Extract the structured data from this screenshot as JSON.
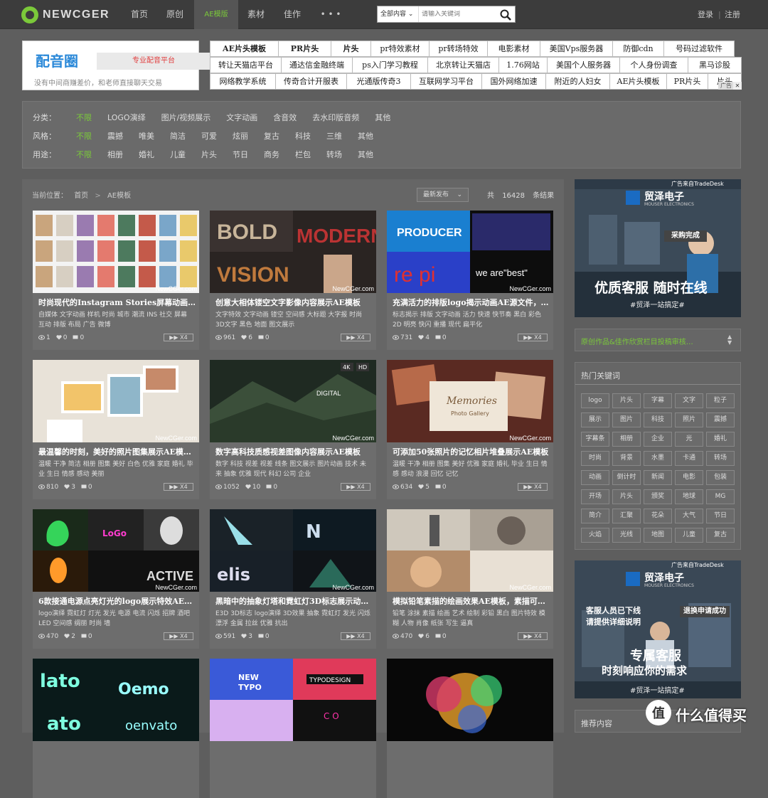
{
  "brand": "NEWCGER",
  "nav": [
    "首页",
    "原创",
    "AE模版",
    "素材",
    "佳作",
    "• • •"
  ],
  "search": {
    "scope": "全部内容",
    "placeholder": "请输入关键词"
  },
  "auth": {
    "login": "登录",
    "register": "注册"
  },
  "ad_left": {
    "title": "配音圈",
    "pill": "专业配音平台",
    "sub": "没有中间商赚差价，和老师直接聊天交易"
  },
  "ad_links": [
    [
      "AE片头模板",
      "PR片头",
      "片头",
      "pr特效素材",
      "pr转场特效",
      "电影素材",
      "美国Vps服务器",
      "防御cdn",
      "号码过滤软件"
    ],
    [
      "转让天猫店平台",
      "通达信金融终端",
      "ps入门学习教程",
      "北京转让天猫店",
      "1.76网站",
      "美国个人服务器",
      "个人身份调查",
      "黑马诊股"
    ],
    [
      "网络教学系统",
      "传奇合计开服表",
      "光通版传奇3",
      "互联网学习平台",
      "国外网络加速",
      "附近的人妇女",
      "AE片头模板",
      "PR片头",
      "片头"
    ]
  ],
  "ad_flag": "广告",
  "filters": [
    {
      "label": "分类：",
      "items": [
        "不限",
        "LOGO演绎",
        "图片/视频展示",
        "文字动画",
        "含音效",
        "去水印版音频",
        "其他"
      ]
    },
    {
      "label": "风格：",
      "items": [
        "不限",
        "震撼",
        "唯美",
        "简洁",
        "可爱",
        "炫丽",
        "复古",
        "科技",
        "三维",
        "其他"
      ]
    },
    {
      "label": "用途：",
      "items": [
        "不限",
        "相册",
        "婚礼",
        "儿童",
        "片头",
        "节日",
        "商务",
        "栏包",
        "转场",
        "其他"
      ]
    }
  ],
  "breadcrumb": {
    "prefix": "当前位置：",
    "home": "首页",
    "sep": ">",
    "current": "AE模板"
  },
  "sort": "最新发布",
  "result": {
    "pre": "共",
    "count": "16428",
    "post": "条结果"
  },
  "watermark": "NewCGer.com",
  "play_label": "X4",
  "cards": [
    {
      "title": "时尚现代的Instagram Stories屏幕动画…",
      "tags": "自媒体 文字动画 样机 时尚 城市 潮流 INS 社交 屏幕 互动 排版 布局 广告 微博",
      "views": "1",
      "likes": "0",
      "comments": "0"
    },
    {
      "title": "创意大相体镂空文字影像内容展示AE模板",
      "tags": "文字特效 文字动画 镂空 空间感 大标题 大字报 时尚 3D文字 黑色 地面 图文展示",
      "views": "961",
      "likes": "6",
      "comments": "0"
    },
    {
      "title": "充满活力的排版logo揭示动画AE源文件，…",
      "tags": "标志揭示 排版 文字动画 活力 快速 快节奏 黑白 彩色 2D 明亮 快闪 重播 现代 扁平化",
      "views": "731",
      "likes": "4",
      "comments": "0"
    },
    {
      "title": "最温馨的时刻，美好的照片图集展示AE模…",
      "tags": "温暖 干净 简洁 相册 图集 美好 白色 优雅 家庭 婚礼 毕业 生日 情感 感动 美丽",
      "views": "810",
      "likes": "3",
      "comments": "0"
    },
    {
      "title": "数字高科技质感视差图像内容展示AE模板",
      "tags": "数字 科技 视差 视差 线条 图文展示 图片动画 技术 未来 抽象 优雅 现代 科幻 公司 企业",
      "views": "1052",
      "likes": "10",
      "comments": "0"
    },
    {
      "title": "可添加50张照片的记忆相片堆叠展示AE模板",
      "tags": "温暖 干净 相册 图集 美好 优雅 家庭 婚礼 毕业 生日 情感 感动 浪漫 回忆 记忆",
      "views": "634",
      "likes": "5",
      "comments": "0"
    },
    {
      "title": "6款接通电源点亮灯光的logo展示特效AE…",
      "tags": "logo演绎 霓虹灯 灯光 发光 电源 电流 闪烁 招牌 酒吧 LED 空间感 绸丽 时尚 墙",
      "views": "470",
      "likes": "2",
      "comments": "0"
    },
    {
      "title": "黑暗中的抽象灯塔和霓虹灯3D标志展示动…",
      "tags": "E3D 3D标志 logo演绎 3D效果 抽象 霓虹灯 发光 闪烁 漂浮 金属 拉丝 优雅 抗出",
      "views": "591",
      "likes": "3",
      "comments": "0"
    },
    {
      "title": "模拟铅笔素描的绘画效果AE模板，素描可…",
      "tags": "铅笔 涂抹 素描 绘画 艺术 绘制 彩铅 黑白 图片特效 模糊 人物 肖像 纸张 写生 逼真",
      "views": "470",
      "likes": "6",
      "comments": "0"
    },
    {
      "title": "",
      "tags": "",
      "views": "",
      "likes": "",
      "comments": ""
    },
    {
      "title": "",
      "tags": "",
      "views": "",
      "likes": "",
      "comments": ""
    },
    {
      "title": "",
      "tags": "",
      "views": "",
      "likes": "",
      "comments": ""
    }
  ],
  "side_banner1": {
    "flag": "广告来自TradeDesk",
    "brand": "贸泽电子",
    "brand_en": "MOUSER ELECTRONICS",
    "chip": "采购完成",
    "slogan": "优质客服 随时在线",
    "tag": "#贸泽一站搞定#"
  },
  "notice": "原创作品&佳作欣赏栏目投稿审核…",
  "hot": {
    "title": "热门关键词",
    "words": [
      "logo",
      "片头",
      "字幕",
      "文字",
      "粒子",
      "展示",
      "图片",
      "科技",
      "照片",
      "震撼",
      "字幕条",
      "相册",
      "企业",
      "光",
      "婚礼",
      "时尚",
      "背景",
      "水墨",
      "卡通",
      "转场",
      "动画",
      "倒计时",
      "新闻",
      "电影",
      "包装",
      "开场",
      "片头",
      "颁奖",
      "地球",
      "MG",
      "简介",
      "汇聚",
      "花朵",
      "大气",
      "节日",
      "火焰",
      "光线",
      "地图",
      "儿童",
      "复古"
    ]
  },
  "side_banner2": {
    "flag": "广告来自TradeDesk",
    "brand": "贸泽电子",
    "brand_en": "MOUSER ELECTRONICS",
    "line1": "客服人员已下线",
    "line2": "请提供详细说明",
    "chip": "退换申请成功",
    "slogan": "专属客服",
    "slogan2": "时刻响应你的需求",
    "tag": "#贸泽一站搞定#"
  },
  "recommend": "推荐内容",
  "site_badge": "什么值得买"
}
